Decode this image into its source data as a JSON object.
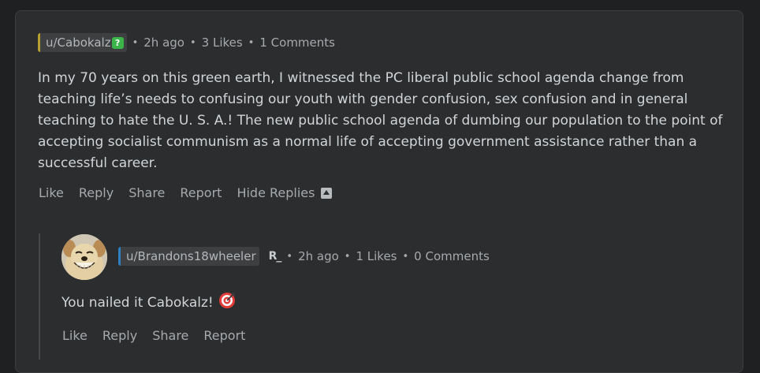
{
  "comment": {
    "username": "u/Cabokalz",
    "verified_badge": "?",
    "time": "2h ago",
    "likes": "3 Likes",
    "comments": "1 Comments",
    "separator": "•",
    "body": "In my 70 years on this green earth, I witnessed the PC liberal public school agenda change from teaching life’s needs to confusing our youth with gender confusion, sex confusion and in general teaching to hate the U. S. A.! The new public school agenda of dumbing our population to the point of accepting socialist communism as a normal life of accepting government assistance rather than a successful career.",
    "actions": {
      "like": "Like",
      "reply": "Reply",
      "share": "Share",
      "report": "Report",
      "hide_replies": "Hide Replies"
    }
  },
  "reply": {
    "username": "u/Brandons18wheeler",
    "rank_badge": "R_",
    "time": "2h ago",
    "likes": "1 Likes",
    "comments": "0 Comments",
    "separator": "•",
    "body": "You nailed it Cabokalz!",
    "actions": {
      "like": "Like",
      "reply": "Reply",
      "share": "Share",
      "report": "Report"
    }
  },
  "icons": {
    "verified": "verified-icon",
    "hide_replies": "collapse-icon",
    "rank": "rank-icon",
    "target_emoji": "target-icon",
    "avatar": "smiling-dog-avatar"
  },
  "colors": {
    "background": "#1f2021",
    "card": "#2b2d2e",
    "chip_accent_gold": "#b8a030",
    "chip_accent_blue": "#2f7fc1",
    "verified_green": "#3bb54a"
  }
}
